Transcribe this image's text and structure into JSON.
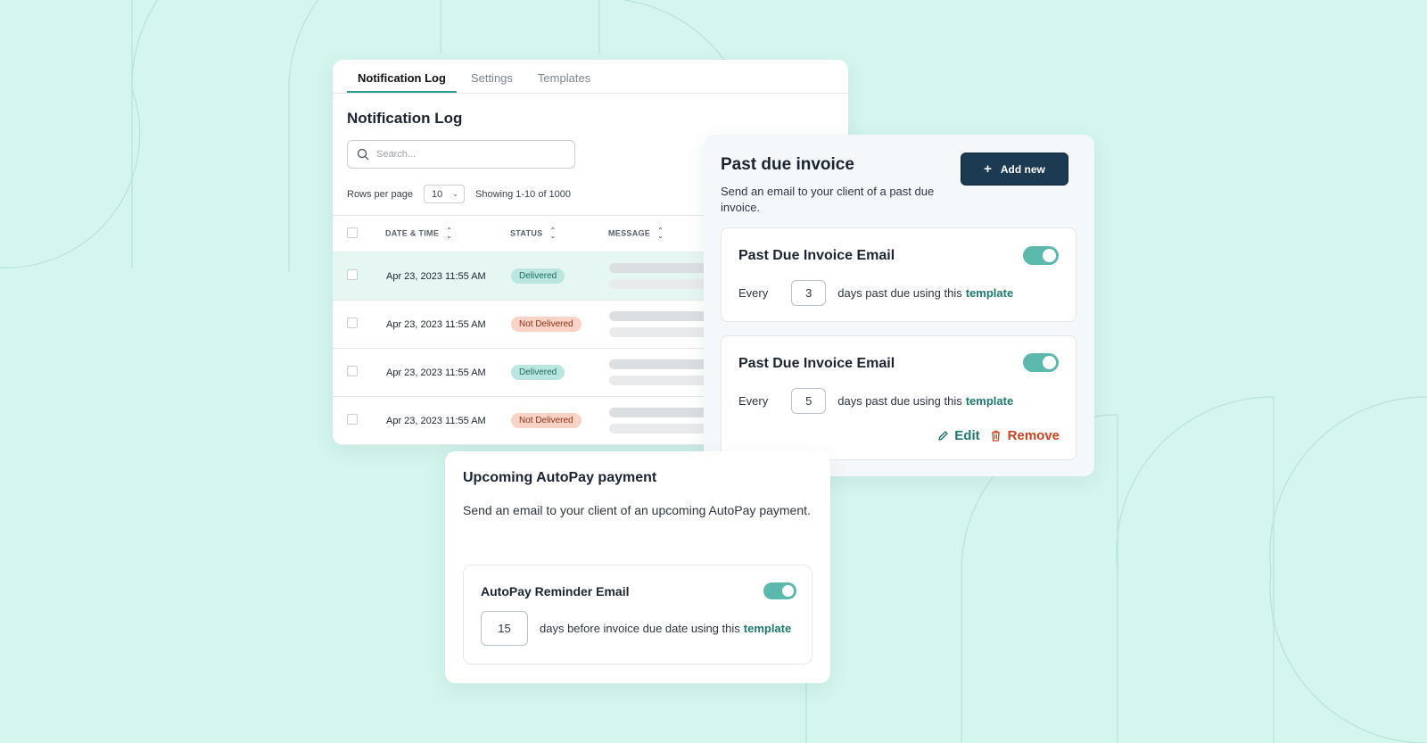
{
  "colors": {
    "background": "#d5f5ef",
    "accent": "#2a9d8f",
    "link": "#1d7a6c",
    "primary_button": "#1c3a52",
    "delivered_badge": "#b9e6df",
    "not_delivered_badge": "#fad3c6",
    "remove": "#d0421c",
    "toggle_on": "#5bb8ad"
  },
  "notification_log": {
    "tabs": [
      {
        "label": "Notification Log",
        "active": true
      },
      {
        "label": "Settings",
        "active": false
      },
      {
        "label": "Templates",
        "active": false
      }
    ],
    "title": "Notification Log",
    "search_placeholder": "Search...",
    "rows_per_page_label": "Rows per page",
    "rows_per_page_value": "10",
    "showing_text": "Showing 1-10 of 1000",
    "columns": [
      "DATE & TIME",
      "STATUS",
      "MESSAGE"
    ],
    "rows": [
      {
        "date": "Apr 23, 2023 11:55 AM",
        "status": "Delivered",
        "highlighted": true
      },
      {
        "date": "Apr 23, 2023 11:55 AM",
        "status": "Not Delivered",
        "highlighted": false
      },
      {
        "date": "Apr 23, 2023 11:55 AM",
        "status": "Delivered",
        "highlighted": false
      },
      {
        "date": "Apr 23, 2023 11:55 AM",
        "status": "Not Delivered",
        "highlighted": false
      }
    ]
  },
  "past_due": {
    "title": "Past due invoice",
    "description": "Send an email to your client of a past due invoice.",
    "add_button_label": "Add new",
    "rules": [
      {
        "title": "Past Due Invoice Email",
        "enabled": true,
        "prefix": "Every",
        "days": "3",
        "suffix": "days past due using this",
        "link": "template"
      },
      {
        "title": "Past Due Invoice Email",
        "enabled": true,
        "prefix": "Every",
        "days": "5",
        "suffix": "days past due using this",
        "link": "template"
      }
    ],
    "edit_label": "Edit",
    "remove_label": "Remove"
  },
  "autopay": {
    "title": "Upcoming AutoPay payment",
    "description": "Send an email to your client of an upcoming AutoPay payment.",
    "rule_title": "AutoPay Reminder Email",
    "enabled": true,
    "days": "15",
    "suffix": "days before invoice due date using this",
    "link": "template"
  }
}
